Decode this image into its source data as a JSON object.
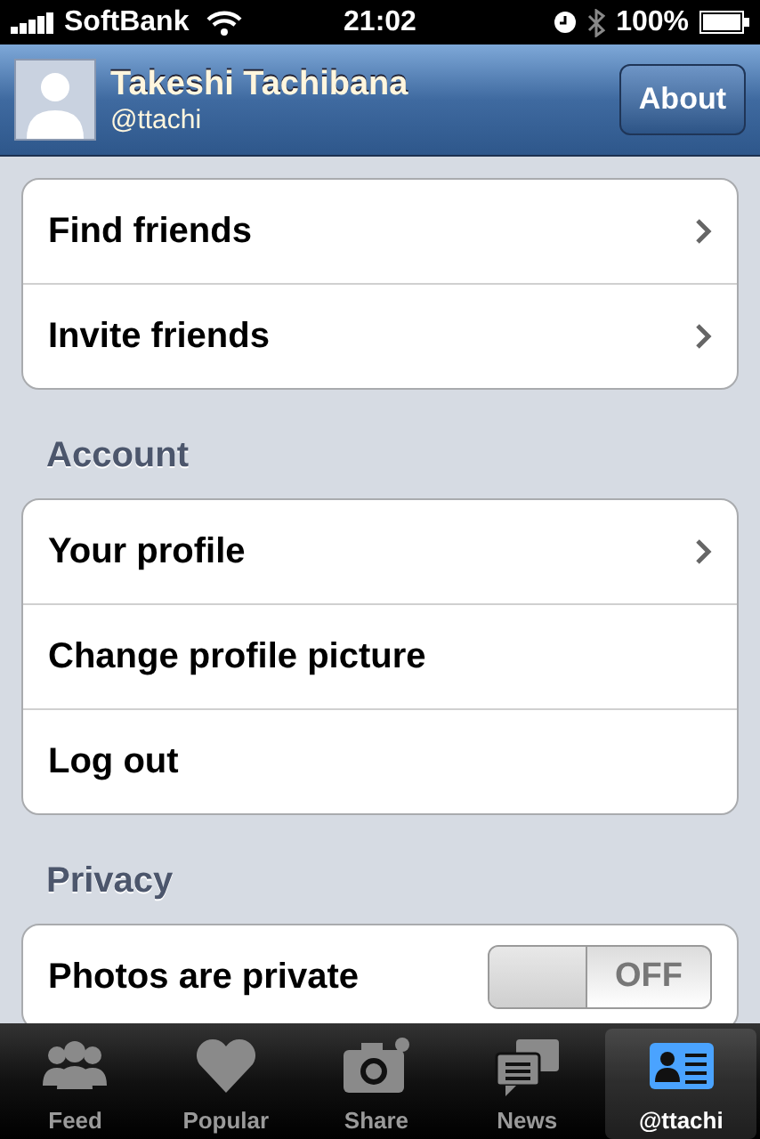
{
  "status_bar": {
    "carrier": "SoftBank",
    "time": "21:02",
    "battery": "100%"
  },
  "header": {
    "name": "Takeshi Tachibana",
    "handle": "@ttachi",
    "button": "About"
  },
  "sections": [
    {
      "items": [
        {
          "label": "Find friends",
          "chevron": true
        },
        {
          "label": "Invite friends",
          "chevron": true
        }
      ]
    },
    {
      "title": "Account",
      "items": [
        {
          "label": "Your profile",
          "chevron": true
        },
        {
          "label": "Change profile picture",
          "chevron": false
        },
        {
          "label": "Log out",
          "chevron": false
        }
      ]
    },
    {
      "title": "Privacy",
      "items": [
        {
          "label": "Photos are private",
          "chevron": false,
          "toggle": {
            "on": false,
            "label": "OFF"
          }
        }
      ]
    }
  ],
  "tabs": [
    {
      "kind": "feed",
      "label": "Feed",
      "selected": false
    },
    {
      "kind": "popular",
      "label": "Popular",
      "selected": false
    },
    {
      "kind": "share",
      "label": "Share",
      "selected": false
    },
    {
      "kind": "news",
      "label": "News",
      "selected": false
    },
    {
      "kind": "profile",
      "label": "@ttachi",
      "selected": true
    }
  ]
}
